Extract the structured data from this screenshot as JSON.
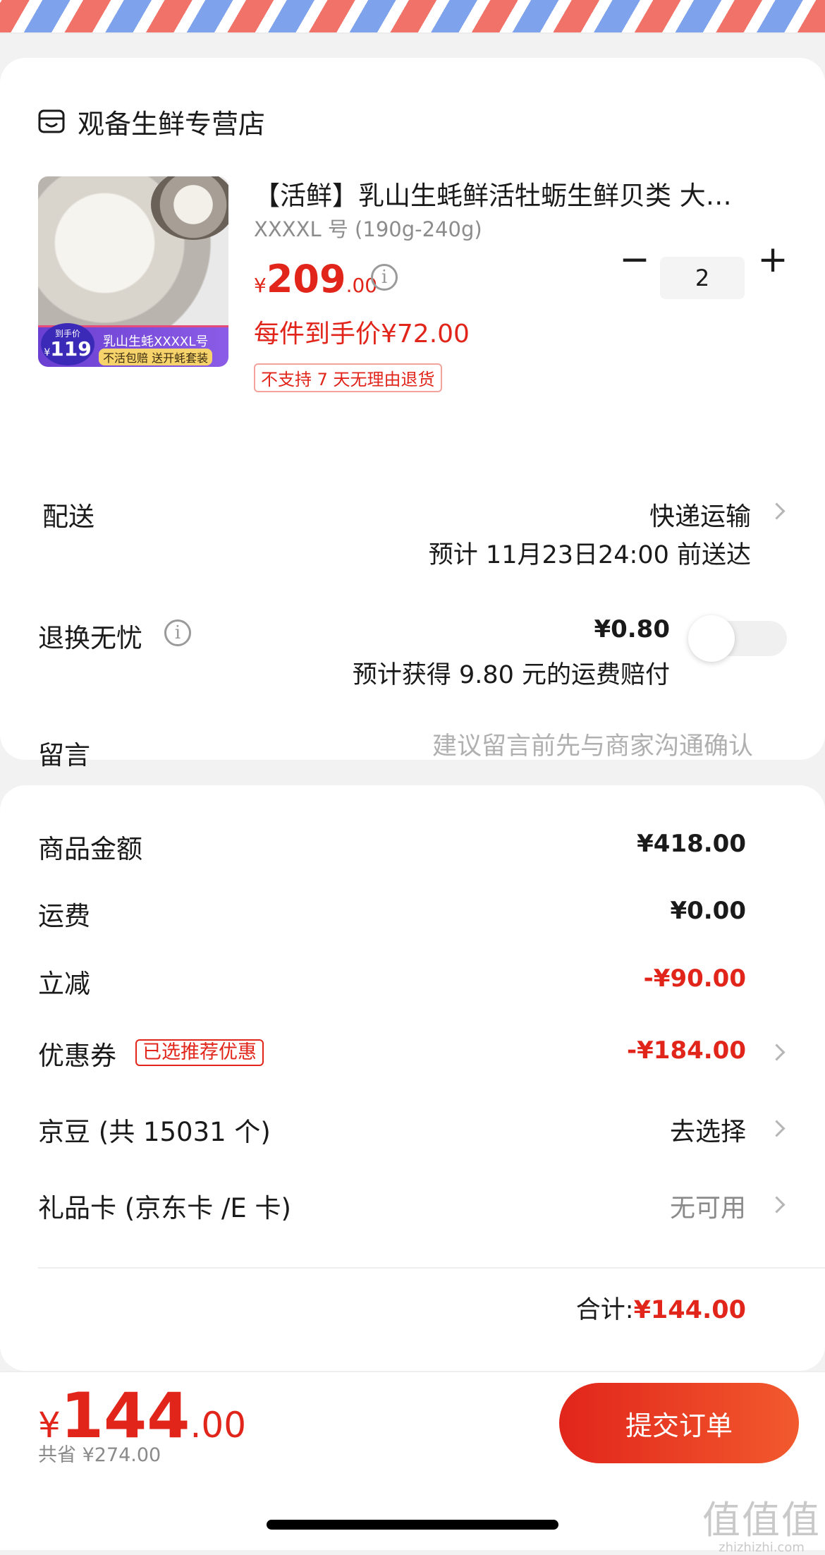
{
  "shop": {
    "name": "观备生鲜专营店"
  },
  "product": {
    "title": "【活鲜】乳山生蚝鲜活牡蛎生鲜贝类 大…",
    "spec": "XXXXL 号 (190g-240g)",
    "price_currency": "¥",
    "price_int": "209",
    "price_dec": ".00",
    "price_each": "每件到手价¥72.00",
    "return_policy": "不支持 7 天无理由退货",
    "quantity": "2",
    "thumb_badge": {
      "tag": "到手价",
      "currency": "¥",
      "price": "119",
      "title": "乳山生蚝XXXXL号",
      "subtitle": "不活包赔 送开蚝套装"
    }
  },
  "delivery": {
    "label": "配送",
    "method": "快递运输",
    "eta": "预计 11月23日24:00 前送达"
  },
  "worry_free": {
    "label": "退换无忧",
    "price": "¥0.80",
    "note": "预计获得 9.80 元的运费赔付",
    "enabled": false
  },
  "message": {
    "label": "留言",
    "placeholder": "建议留言前先与商家沟通确认"
  },
  "summary": {
    "goods_label": "商品金额",
    "goods_value": "¥418.00",
    "shipping_label": "运费",
    "shipping_value": "¥0.00",
    "discount_label": "立减",
    "discount_value": "-¥90.00",
    "coupon_label": "优惠券",
    "coupon_tag": "已选推荐优惠",
    "coupon_value": "-¥184.00",
    "jingdou_label": "京豆 (共 15031 个)",
    "jingdou_value": "去选择",
    "giftcard_label": "礼品卡 (京东卡 /E 卡)",
    "giftcard_value": "无可用",
    "total_label": "合计:",
    "total_value": "¥144.00"
  },
  "footer": {
    "currency": "¥",
    "pay_int": "144",
    "pay_dec": ".00",
    "savings": "共省 ¥274.00",
    "submit_label": "提交订单"
  },
  "watermark": {
    "logo": "值值值",
    "site": "zhizhizhi.com"
  },
  "colors": {
    "accent": "#e1251b",
    "muted": "#8a8a8a",
    "airmail_red": "#f07268",
    "airmail_blue": "#7fa2ec"
  }
}
